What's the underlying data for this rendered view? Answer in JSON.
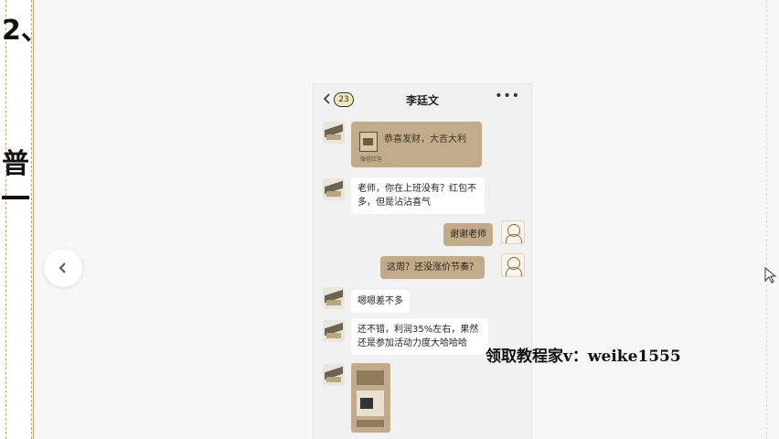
{
  "slide": {
    "step_number": "2、",
    "step_title": "普"
  },
  "chat": {
    "back_icon": "chevron-left-icon",
    "unread_count": "23",
    "title": "李廷文",
    "more_icon": "more-dots-icon",
    "red_packet": {
      "text": "恭喜发财，大吉大利",
      "sub": "微信红包"
    },
    "messages": [
      {
        "from": "other",
        "text": "老师，你在上班没有？红包不多，但是沾沾喜气"
      },
      {
        "from": "me",
        "text": "谢谢老师"
      },
      {
        "from": "me",
        "text": "这周？还没涨价节奏？"
      },
      {
        "from": "other",
        "text": "嗯嗯差不多"
      },
      {
        "from": "other",
        "text": "还不错，利润35%左右，果然还是参加活动力度大哈哈哈"
      }
    ]
  },
  "watermark": "领取教程家v：weike1555",
  "colors": {
    "accent_tan": "#c2ab8a",
    "guide_line": "#c9a574"
  }
}
